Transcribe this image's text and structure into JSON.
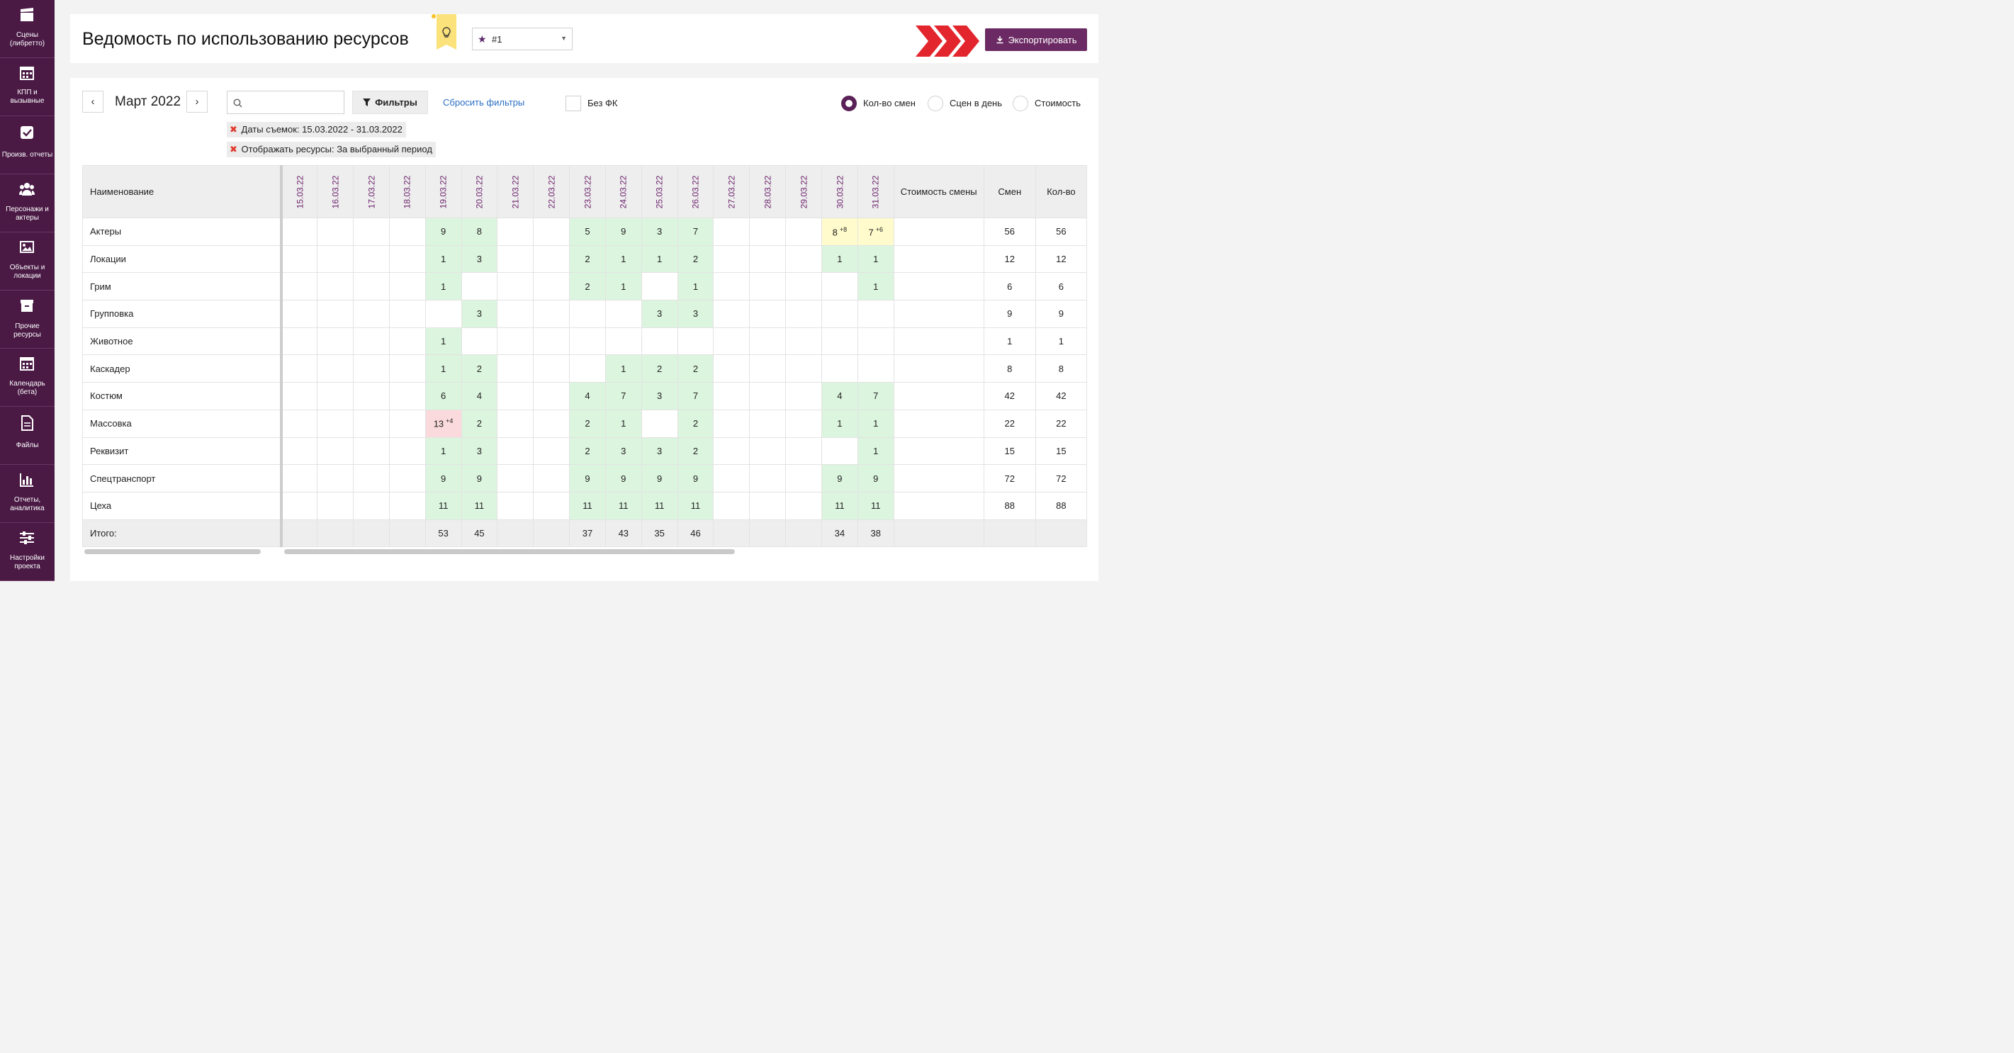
{
  "sidebar": {
    "items": [
      {
        "label": "Сцены (либретто)",
        "icon": "clapperboard-icon"
      },
      {
        "label": "КПП и вызывные",
        "icon": "calendar-icon"
      },
      {
        "label": "Произв. отчеты",
        "icon": "checkbox-icon"
      },
      {
        "label": "Персонажи и актеры",
        "icon": "people-icon"
      },
      {
        "label": "Объекты и локации",
        "icon": "image-icon"
      },
      {
        "label": "Прочие ресурсы",
        "icon": "archive-icon"
      },
      {
        "label": "Календарь (бета)",
        "icon": "calendar-icon"
      },
      {
        "label": "Файлы",
        "icon": "file-icon"
      },
      {
        "label": "Отчеты, аналитика",
        "icon": "bar-chart-icon"
      },
      {
        "label": "Настройки проекта",
        "icon": "sliders-icon"
      }
    ]
  },
  "header": {
    "title": "Ведомость по использованию ресурсов",
    "preset_value": "#1",
    "export_label": "Экспортировать"
  },
  "toolbar": {
    "month": "Март 2022",
    "search_placeholder": "",
    "filters_label": "Фильтры",
    "reset_label": "Сбросить фильтры",
    "no_fk_label": "Без ФК",
    "radios": [
      {
        "label": "Кол-во смен",
        "selected": true
      },
      {
        "label": "Сцен в день",
        "selected": false
      },
      {
        "label": "Стоимость",
        "selected": false
      }
    ]
  },
  "chips": [
    {
      "key": "Даты съемок:",
      "value": "15.03.2022 - 31.03.2022"
    },
    {
      "key": "Отображать ресурсы:",
      "value": "За выбранный период"
    }
  ],
  "table": {
    "name_header": "Наименование",
    "dates": [
      "15.03.22",
      "16.03.22",
      "17.03.22",
      "18.03.22",
      "19.03.22",
      "20.03.22",
      "21.03.22",
      "22.03.22",
      "23.03.22",
      "24.03.22",
      "25.03.22",
      "26.03.22",
      "27.03.22",
      "28.03.22",
      "29.03.22",
      "30.03.22",
      "31.03.22"
    ],
    "cost_header": "Стоимость смены",
    "shifts_header": "Смен",
    "count_header": "Кол-во",
    "rows": [
      {
        "name": "Актеры",
        "cells": [
          "",
          "",
          "",
          "",
          "9",
          "8",
          "",
          "",
          "5",
          "9",
          "3",
          "7",
          "",
          "",
          "",
          "8",
          "7"
        ],
        "extra": {
          "15": "+8",
          "16": "+6"
        },
        "cost": "",
        "shifts": "56",
        "count": "56"
      },
      {
        "name": "Локации",
        "cells": [
          "",
          "",
          "",
          "",
          "1",
          "3",
          "",
          "",
          "2",
          "1",
          "1",
          "2",
          "",
          "",
          "",
          "1",
          "1"
        ],
        "extra": {},
        "cost": "",
        "shifts": "12",
        "count": "12"
      },
      {
        "name": "Грим",
        "cells": [
          "",
          "",
          "",
          "",
          "1",
          "",
          "",
          "",
          "2",
          "1",
          "",
          "1",
          "",
          "",
          "",
          "",
          "1"
        ],
        "extra": {},
        "cost": "",
        "shifts": "6",
        "count": "6"
      },
      {
        "name": "Групповка",
        "cells": [
          "",
          "",
          "",
          "",
          "",
          "3",
          "",
          "",
          "",
          "",
          "3",
          "3",
          "",
          "",
          "",
          "",
          ""
        ],
        "extra": {},
        "cost": "",
        "shifts": "9",
        "count": "9"
      },
      {
        "name": "Животное",
        "cells": [
          "",
          "",
          "",
          "",
          "1",
          "",
          "",
          "",
          "",
          "",
          "",
          "",
          "",
          "",
          "",
          "",
          ""
        ],
        "extra": {},
        "cost": "",
        "shifts": "1",
        "count": "1"
      },
      {
        "name": "Каскадер",
        "cells": [
          "",
          "",
          "",
          "",
          "1",
          "2",
          "",
          "",
          "",
          "1",
          "2",
          "2",
          "",
          "",
          "",
          "",
          ""
        ],
        "extra": {},
        "cost": "",
        "shifts": "8",
        "count": "8"
      },
      {
        "name": "Костюм",
        "cells": [
          "",
          "",
          "",
          "",
          "6",
          "4",
          "",
          "",
          "4",
          "7",
          "3",
          "7",
          "",
          "",
          "",
          "4",
          "7"
        ],
        "extra": {},
        "cost": "",
        "shifts": "42",
        "count": "42"
      },
      {
        "name": "Массовка",
        "cells": [
          "",
          "",
          "",
          "",
          "13",
          "2",
          "",
          "",
          "2",
          "1",
          "",
          "2",
          "",
          "",
          "",
          "1",
          "1"
        ],
        "extra": {
          "4": "+4"
        },
        "cost": "",
        "shifts": "22",
        "count": "22"
      },
      {
        "name": "Реквизит",
        "cells": [
          "",
          "",
          "",
          "",
          "1",
          "3",
          "",
          "",
          "2",
          "3",
          "3",
          "2",
          "",
          "",
          "",
          "",
          "1"
        ],
        "extra": {},
        "cost": "",
        "shifts": "15",
        "count": "15"
      },
      {
        "name": "Спецтранспорт",
        "cells": [
          "",
          "",
          "",
          "",
          "9",
          "9",
          "",
          "",
          "9",
          "9",
          "9",
          "9",
          "",
          "",
          "",
          "9",
          "9"
        ],
        "extra": {},
        "cost": "",
        "shifts": "72",
        "count": "72"
      },
      {
        "name": "Цеха",
        "cells": [
          "",
          "",
          "",
          "",
          "11",
          "11",
          "",
          "",
          "11",
          "11",
          "11",
          "11",
          "",
          "",
          "",
          "11",
          "11"
        ],
        "extra": {},
        "cost": "",
        "shifts": "88",
        "count": "88"
      }
    ],
    "total": {
      "name": "Итого:",
      "cells": [
        "",
        "",
        "",
        "",
        "53",
        "45",
        "",
        "",
        "37",
        "43",
        "35",
        "46",
        "",
        "",
        "",
        "34",
        "38"
      ]
    },
    "colors": {
      "green": "#dcf5df",
      "yellow": "#fffbcc",
      "red": "#fadadd",
      "accent": "#6b2a63"
    }
  }
}
